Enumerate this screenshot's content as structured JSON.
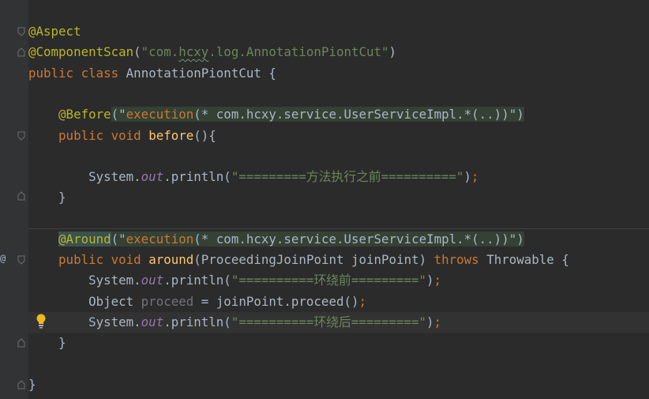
{
  "colors": {
    "background": "#2b2b2b",
    "gutter": "#313335",
    "annotation": "#bbb529",
    "keyword": "#cc7832",
    "string": "#6a8759",
    "static_field": "#9876aa",
    "method_declaration": "#ffc66d",
    "default_text": "#a9b7c6"
  },
  "gutter": {
    "fold_icon": "fold-marker-icon",
    "intention_icon": "lightbulb-icon",
    "aspect_marker": "@"
  },
  "code": {
    "l1": {
      "ann": "@Aspect"
    },
    "l2": {
      "ann": "@ComponentScan",
      "open": "(",
      "str_a": "\"com.",
      "str_b": "hcxy",
      "str_c": ".log.AnnotationPiontCut\"",
      "close": ")"
    },
    "l3": {
      "kw1": "public",
      "kw2": "class",
      "name": "AnnotationPiontCut {"
    },
    "l5": {
      "indent": "    ",
      "ann": "@Before",
      "open": "(\"",
      "expr_kw": "execution",
      "expr_rest": "(* com.hcxy.service.UserServiceImpl.*(..))",
      "close": "\")"
    },
    "l6": {
      "indent": "    ",
      "kw1": "public",
      "kw2": "void",
      "fn": "before",
      "rest": "(){"
    },
    "l8": {
      "indent": "        ",
      "cls": "System.",
      "fld": "out",
      "call": ".println(",
      "str": "\"=========方法执行之前==========\"",
      "close": ")",
      "semi": ";"
    },
    "l9": {
      "indent": "    ",
      "brace": "}"
    },
    "l11": {
      "indent": "    ",
      "ann": "@Around",
      "open": "(\"",
      "expr_kw": "execution",
      "expr_rest": "(* com.hcxy.service.UserServiceImpl.*(..))",
      "close": "\")"
    },
    "l12": {
      "indent": "    ",
      "kw1": "public",
      "kw2": "void",
      "fn": "around",
      "params": "(ProceedingJoinPoint joinPoint) ",
      "kw3": "throws",
      "rest": " Throwable {"
    },
    "l13": {
      "indent": "        ",
      "cls": "System.",
      "fld": "out",
      "call": ".println(",
      "str": "\"==========环绕前=========\"",
      "close": ")",
      "semi": ";"
    },
    "l14": {
      "indent": "        ",
      "type": "Object ",
      "unused_var": "proceed",
      "rest": " = joinPoint.proceed()",
      "semi": ";"
    },
    "l15": {
      "indent": "        ",
      "cls": "System.",
      "fld": "out",
      "call": ".println(",
      "str": "\"==========环绕后=========\"",
      "close": ")",
      "semi": ";"
    },
    "l16": {
      "indent": "    ",
      "brace": "}"
    },
    "l18": {
      "brace": "}"
    }
  }
}
